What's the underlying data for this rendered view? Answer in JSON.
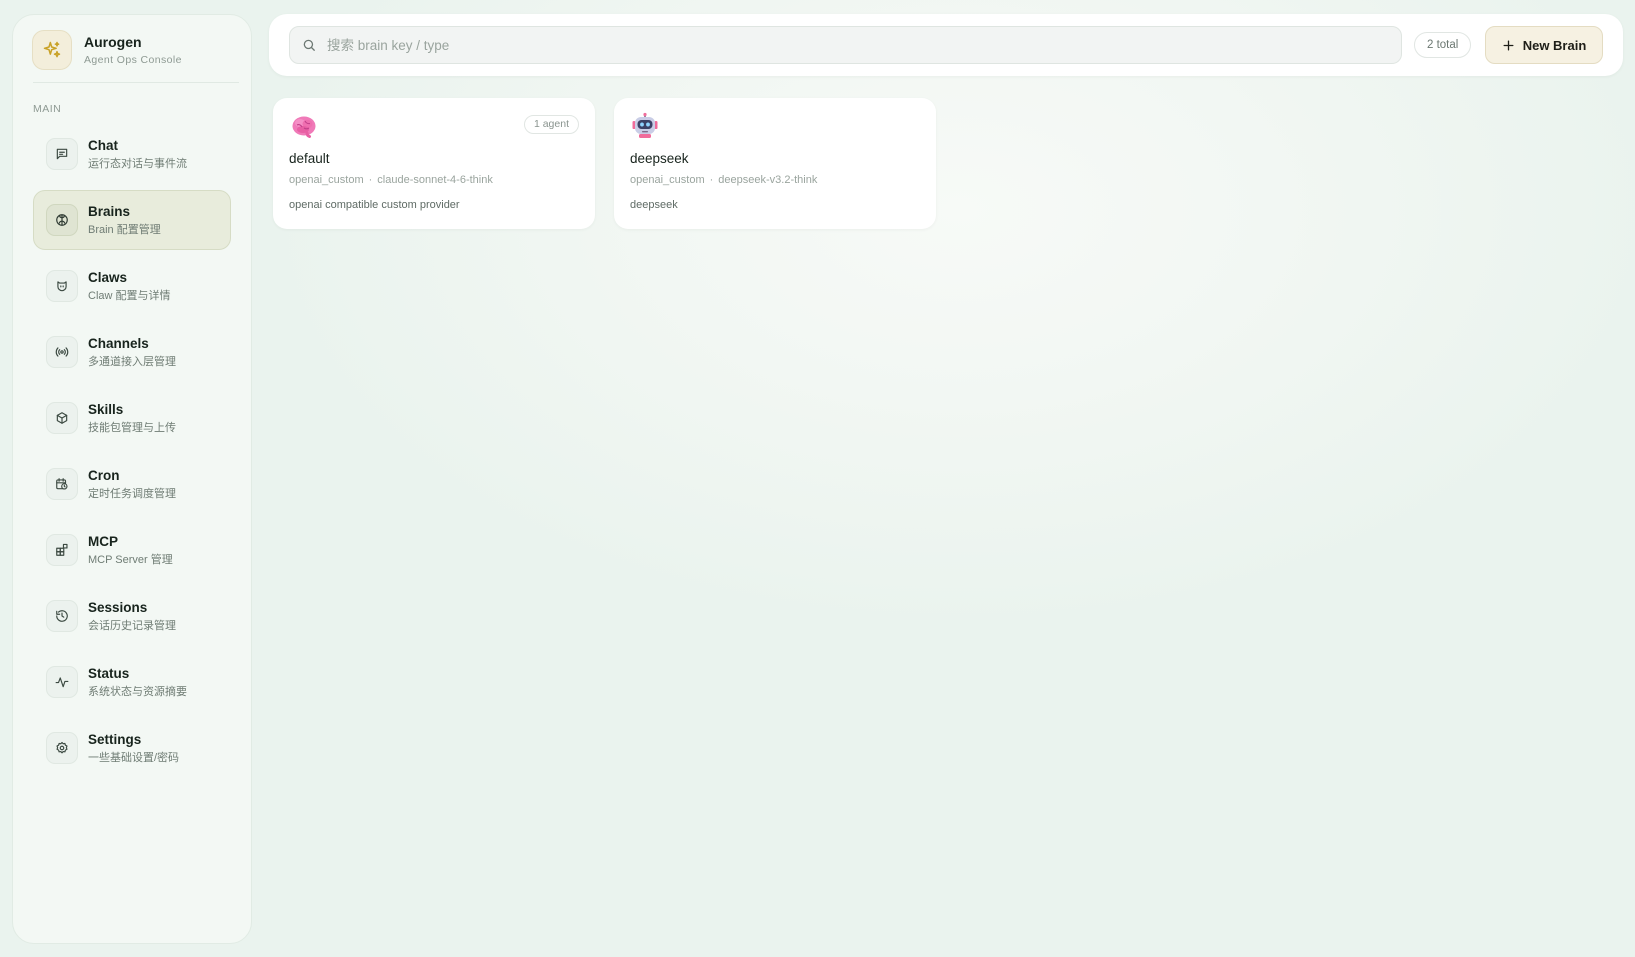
{
  "brand": {
    "name": "Aurogen",
    "subtitle": "Agent Ops Console"
  },
  "sidebar": {
    "section_label": "MAIN",
    "items": [
      {
        "title": "Chat",
        "subtitle": "运行态对话与事件流",
        "icon": "chat-icon"
      },
      {
        "title": "Brains",
        "subtitle": "Brain 配置管理",
        "icon": "brain-icon",
        "active": true
      },
      {
        "title": "Claws",
        "subtitle": "Claw 配置与详情",
        "icon": "claw-icon"
      },
      {
        "title": "Channels",
        "subtitle": "多通道接入层管理",
        "icon": "broadcast-icon"
      },
      {
        "title": "Skills",
        "subtitle": "技能包管理与上传",
        "icon": "package-icon"
      },
      {
        "title": "Cron",
        "subtitle": "定时任务调度管理",
        "icon": "calendar-clock-icon"
      },
      {
        "title": "MCP",
        "subtitle": "MCP Server 管理",
        "icon": "blocks-icon"
      },
      {
        "title": "Sessions",
        "subtitle": "会话历史记录管理",
        "icon": "history-icon"
      },
      {
        "title": "Status",
        "subtitle": "系统状态与资源摘要",
        "icon": "activity-icon"
      },
      {
        "title": "Settings",
        "subtitle": "一些基础设置/密码",
        "icon": "gear-icon"
      }
    ]
  },
  "toolbar": {
    "search_placeholder": "搜索 brain key / type",
    "search_value": "",
    "total_label": "2 total",
    "new_button_label": "New Brain"
  },
  "brains": [
    {
      "name": "default",
      "provider": "openai_custom",
      "model": "claude-sonnet-4-6-think",
      "description": "openai compatible custom provider",
      "badge": "1 agent",
      "icon": "brain-emoji-icon"
    },
    {
      "name": "deepseek",
      "provider": "openai_custom",
      "model": "deepseek-v3.2-think",
      "description": "deepseek",
      "badge": "",
      "icon": "robot-emoji-icon"
    }
  ],
  "colors": {
    "active_nav_bg": "#e8ecdc",
    "accent_button_bg": "#f6f1e2",
    "page_bg": "#eef5f0"
  }
}
